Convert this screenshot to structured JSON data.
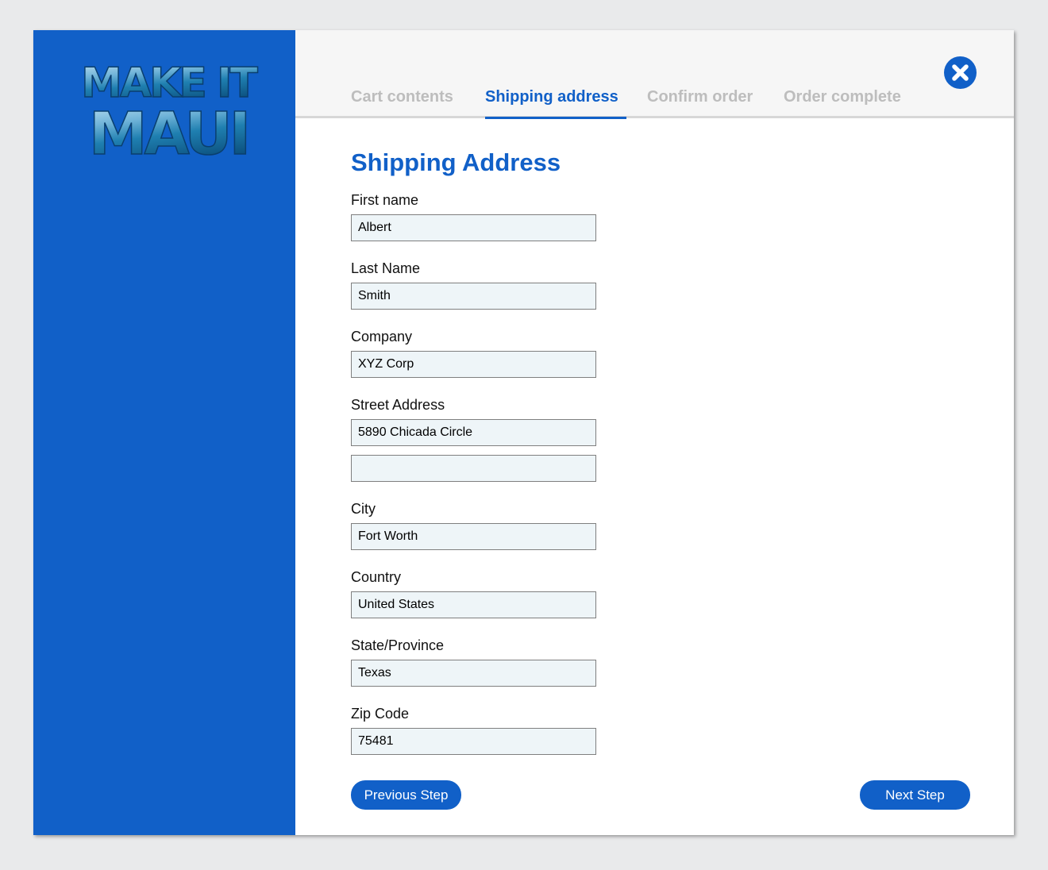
{
  "brand": {
    "logo_line1": "MAKE IT",
    "logo_line2": "MAUI",
    "accent_color": "#1160c8"
  },
  "tabs": [
    {
      "label": "Cart contents",
      "active": false
    },
    {
      "label": "Shipping address",
      "active": true
    },
    {
      "label": "Confirm order",
      "active": false
    },
    {
      "label": "Order complete",
      "active": false
    }
  ],
  "close_icon": "close-circle-icon",
  "form": {
    "title": "Shipping Address",
    "first_name": {
      "label": "First name",
      "value": "Albert"
    },
    "last_name": {
      "label": "Last Name",
      "value": "Smith"
    },
    "company": {
      "label": "Company",
      "value": "XYZ Corp"
    },
    "street": {
      "label": "Street Address",
      "value1": "5890 Chicada Circle",
      "value2": ""
    },
    "city": {
      "label": "City",
      "value": "Fort Worth"
    },
    "country": {
      "label": "Country",
      "value": "United States"
    },
    "state": {
      "label": "State/Province",
      "value": "Texas"
    },
    "zip": {
      "label": "Zip Code",
      "value": "75481"
    }
  },
  "buttons": {
    "previous": "Previous Step",
    "next": "Next Step"
  }
}
